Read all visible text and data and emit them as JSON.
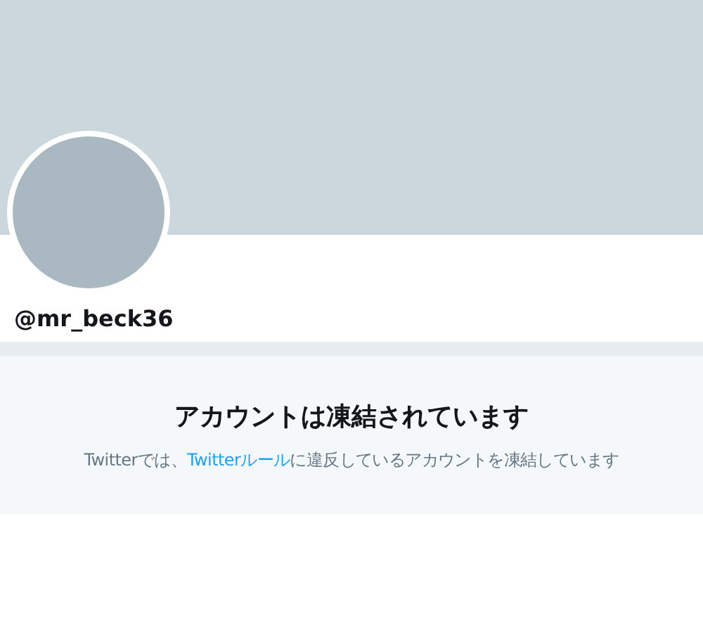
{
  "profile": {
    "username": "@mr_beck36"
  },
  "notice": {
    "title": "アカウントは凍結されています",
    "text_before": "Twitterでは、",
    "link": "Twitterルール",
    "text_after": "に違反しているアカウントを凍結しています"
  }
}
